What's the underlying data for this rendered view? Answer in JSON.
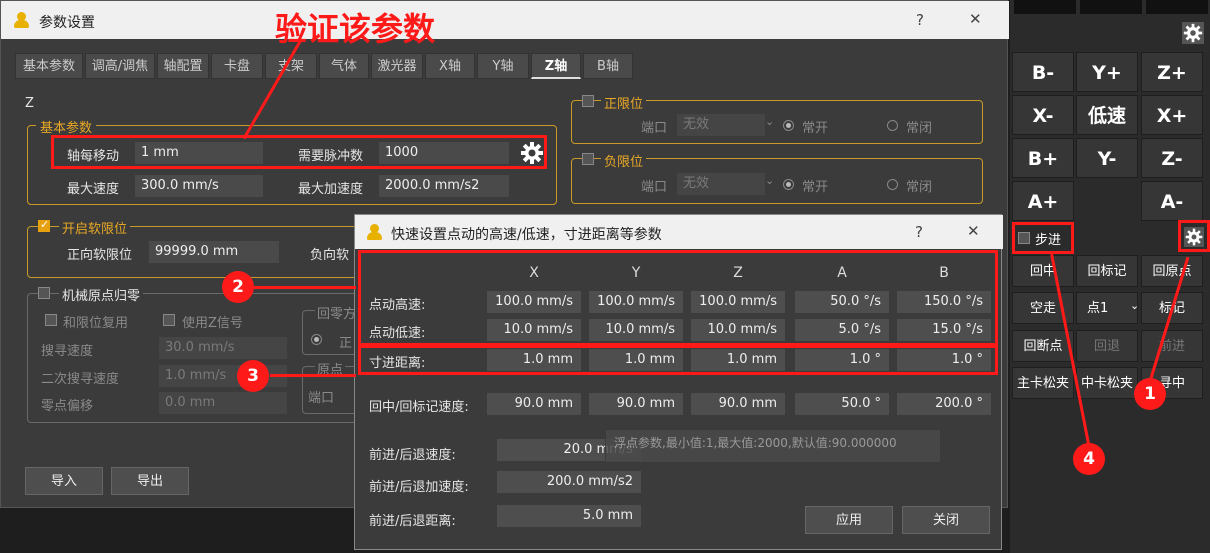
{
  "param_window": {
    "title": "参数设置",
    "help": "?",
    "close": "✕",
    "tabs": [
      "基本参数",
      "调高/调焦",
      "轴配置",
      "卡盘",
      "支架",
      "气体",
      "激光器",
      "X轴",
      "Y轴",
      "Z轴",
      "B轴"
    ],
    "active_tab": "Z轴",
    "axis_name": "Z",
    "basic": {
      "title": "基本参数",
      "move_label": "轴每移动",
      "move_value": "1 mm",
      "pulse_label": "需要脉冲数",
      "pulse_value": "1000",
      "speed_label": "最大速度",
      "speed_value": "300.0 mm/s",
      "accel_label": "最大加速度",
      "accel_value": "2000.0 mm/s2"
    },
    "soft_limit": {
      "title": "开启软限位",
      "pos_label": "正向软限位",
      "pos_value": "99999.0 mm",
      "neg_label": "负向软"
    },
    "home": {
      "title": "机械原点归零",
      "limit_reuse": "和限位复用",
      "use_z": "使用Z信号",
      "search_label": "搜寻速度",
      "search_value": "30.0 mm/s",
      "second_label": "二次搜寻速度",
      "second_value": "1.0 mm/s",
      "offset_label": "零点偏移",
      "offset_value": "0.0 mm",
      "dir_label": "回零方",
      "dir_opt": "正",
      "port_group": "原点",
      "port_label": "端口"
    },
    "pos_limit": {
      "title": "正限位",
      "port_label": "端口",
      "port_value": "无效",
      "normal_open": "常开",
      "normal_close": "常闭"
    },
    "neg_limit": {
      "title": "负限位",
      "port_label": "端口",
      "port_value": "无效",
      "normal_open": "常开",
      "normal_close": "常闭"
    },
    "import_label": "导入",
    "export_label": "导出"
  },
  "quick_dialog": {
    "title": "快速设置点动的高速/低速，寸进距离等参数",
    "help": "?",
    "close": "✕",
    "columns": [
      "X",
      "Y",
      "Z",
      "A",
      "B"
    ],
    "rows": [
      {
        "label": "点动高速:",
        "values": [
          "100.0 mm/s",
          "100.0 mm/s",
          "100.0 mm/s",
          "50.0 °/s",
          "150.0 °/s"
        ]
      },
      {
        "label": "点动低速:",
        "values": [
          "10.0 mm/s",
          "10.0 mm/s",
          "10.0 mm/s",
          "5.0 °/s",
          "15.0 °/s"
        ]
      },
      {
        "label": "寸进距离:",
        "values": [
          "1.0 mm",
          "1.0 mm",
          "1.0 mm",
          "1.0 °",
          "1.0 °"
        ]
      },
      {
        "label": "回中/回标记速度:",
        "values": [
          "90.0 mm",
          "90.0 mm",
          "90.0 mm",
          "50.0 °",
          "200.0 °"
        ]
      }
    ],
    "fwd_speed_label": "前进/后退速度:",
    "fwd_speed_value": "20.0 mm/s",
    "fwd_accel_label": "前进/后退加速度:",
    "fwd_accel_value": "200.0 mm/s2",
    "fwd_dist_label": "前进/后退距离:",
    "fwd_dist_value": "5.0 mm",
    "tooltip": "浮点参数,最小值:1,最大值:2000,默认值:90.000000",
    "apply_label": "应用",
    "close_label": "关闭"
  },
  "right_panel": {
    "jog": [
      "B-",
      "Y+",
      "Z+",
      "X-",
      "低速",
      "X+",
      "B+",
      "Y-",
      "Z-",
      "A+",
      "A-"
    ],
    "step_label": "步进",
    "buttons_row1": [
      "回中",
      "回标记",
      "回原点"
    ],
    "buttons_row2": [
      "空走",
      "点1",
      "标记"
    ],
    "buttons_row3": [
      "回断点",
      "回退",
      "前进"
    ],
    "buttons_row4": [
      "主卡松夹",
      "中卡松夹",
      "寻中"
    ]
  },
  "annotations": {
    "verify_text": "验证该参数",
    "badges": [
      "1",
      "2",
      "3",
      "4"
    ],
    "accent_color": "#ff1a1a"
  }
}
